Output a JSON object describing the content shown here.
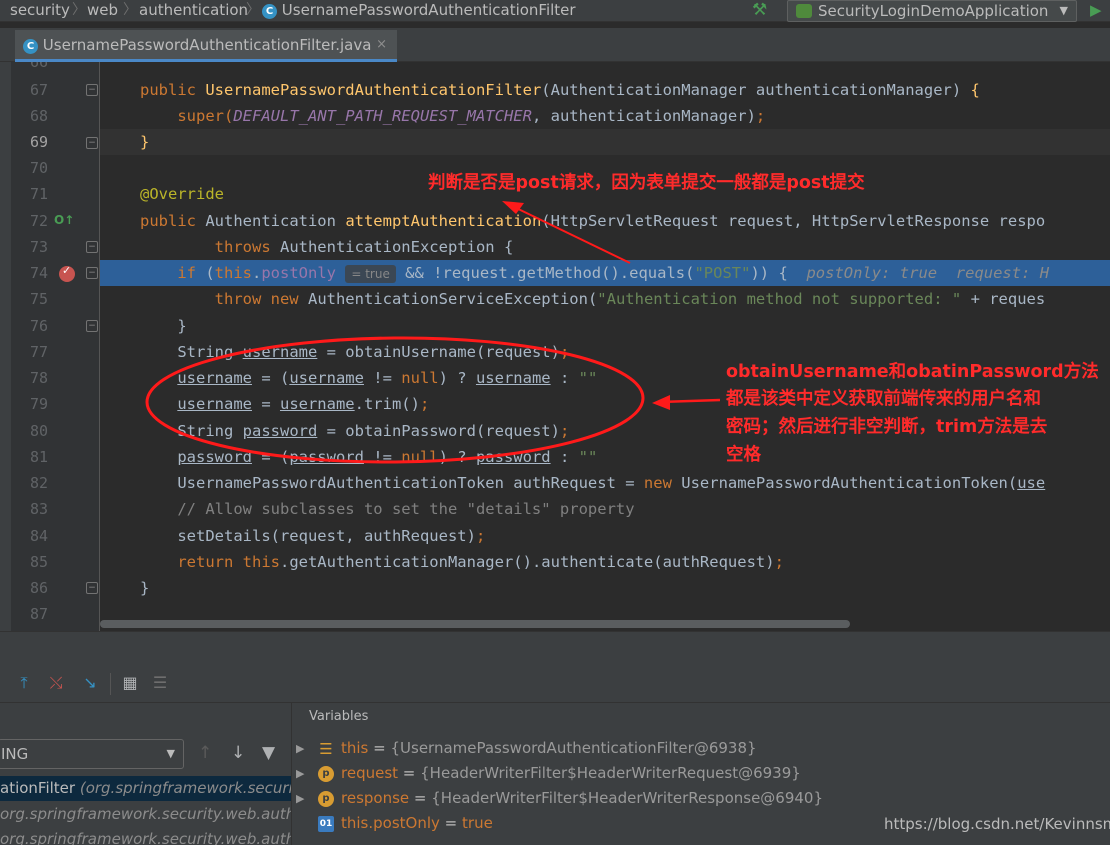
{
  "navbar": {
    "crumbs": [
      "security",
      "web",
      "authentication",
      "UsernamePasswordAuthenticationFilter"
    ],
    "run_config": "SecurityLoginDemoApplication"
  },
  "tab": {
    "label": "UsernamePasswordAuthenticationFilter.java",
    "close": "×"
  },
  "editor": {
    "line_numbers": [
      "66",
      "67",
      "68",
      "69",
      "70",
      "71",
      "72",
      "73",
      "74",
      "75",
      "76",
      "77",
      "78",
      "79",
      "80",
      "81",
      "82",
      "83",
      "84",
      "85",
      "86",
      "87"
    ],
    "inlay_hint": "= true",
    "debug_inline": "postOnly: true  request: H",
    "lines": {
      "l67": {
        "t1": "public ",
        "t2": "UsernamePasswordAuthenticationFilter",
        "t3": "(AuthenticationManager authenticationManager) ",
        "t4": "{"
      },
      "l68": {
        "t1": "super(",
        "t2": "DEFAULT_ANT_PATH_REQUEST_MATCHER",
        "t3": ", authenticationManager)",
        "t4": ";"
      },
      "l69": {
        "t1": "}"
      },
      "l71": {
        "t1": "@Override"
      },
      "l72": {
        "t1": "public ",
        "t2": "Authentication ",
        "t3": "attemptAuthentication",
        "t4": "(HttpServletRequest request, HttpServletResponse respo"
      },
      "l73": {
        "t1": "throws ",
        "t2": "AuthenticationException {"
      },
      "l74": {
        "t1": "if ",
        "t2": "(",
        "t3": "this",
        "t4": ".",
        "t5": "postOnly",
        "t6": " && !request.getMethod().equals(",
        "t7": "\"POST\"",
        "t8": ")) {  "
      },
      "l75": {
        "t1": "throw new ",
        "t2": "AuthenticationServiceException(",
        "t3": "\"Authentication method not supported: \"",
        "t4": " + reques"
      },
      "l76": {
        "t1": "}"
      },
      "l77": {
        "t1": "String ",
        "t2": "username",
        "t3": " = obtainUsername(request)",
        "t4": ";"
      },
      "l78": {
        "t1": "username",
        "t2": " = (",
        "t3": "username",
        "t4": " != ",
        "t5": "null",
        "t6": ") ? ",
        "t7": "username",
        "t8": " : ",
        "t9": "\"\""
      },
      "l79": {
        "t1": "username",
        "t2": " = ",
        "t3": "username",
        "t4": ".trim()",
        "t5": ";"
      },
      "l80": {
        "t1": "String ",
        "t2": "password",
        "t3": " = obtainPassword(request)",
        "t4": ";"
      },
      "l81": {
        "t1": "password",
        "t2": " = (",
        "t3": "password",
        "t4": " != ",
        "t5": "null",
        "t6": ") ? ",
        "t7": "password",
        "t8": " : ",
        "t9": "\"\""
      },
      "l82": {
        "t1": "UsernamePasswordAuthenticationToken authRequest = ",
        "t2": "new ",
        "t3": "UsernamePasswordAuthenticationToken(",
        "t4": "use"
      },
      "l83": {
        "t1": "// Allow subclasses to set the \"details\" property"
      },
      "l84": {
        "t1": "setDetails(request, authRequest)",
        "t2": ";"
      },
      "l85": {
        "t1": "return this",
        "t2": ".getAuthenticationManager().authenticate(authRequest)",
        "t3": ";"
      },
      "l86": {
        "t1": "}"
      }
    }
  },
  "annotations": {
    "post_note": "判断是否是post请求，因为表单提交一般都是post提交",
    "obtain_note_1": "obtainUsername和obatinPassword方法",
    "obtain_note_2": "都是该类中定义获取前端传来的用户名和",
    "obtain_note_3": "密码；然后进行非空判断，trim方法是去",
    "obtain_note_4": "空格"
  },
  "debugger": {
    "thread_select": "ING",
    "frames": [
      {
        "name": "ationFilter ",
        "pkg": "(org.springframework.security"
      },
      {
        "name": "",
        "pkg": "org.springframework.security.web.authenti"
      },
      {
        "name": "",
        "pkg": "org.springframework.security.web.authenti"
      }
    ],
    "variables_title": "Variables",
    "variables": [
      {
        "name": "this",
        "value": "{UsernamePasswordAuthenticationFilter@6938}"
      },
      {
        "name": "request",
        "value": "{HeaderWriterFilter$HeaderWriterRequest@6939}"
      },
      {
        "name": "response",
        "value": "{HeaderWriterFilter$HeaderWriterResponse@6940}"
      },
      {
        "name": "this.postOnly",
        "value": "true"
      }
    ],
    "eq": " = "
  },
  "watermark": "https://blog.csdn.net/Kevinnsm",
  "colors": {
    "accent": "#4a88c7",
    "selection": "#2d6099",
    "annotation": "#ff2b2b",
    "keyword": "#cc7832"
  }
}
